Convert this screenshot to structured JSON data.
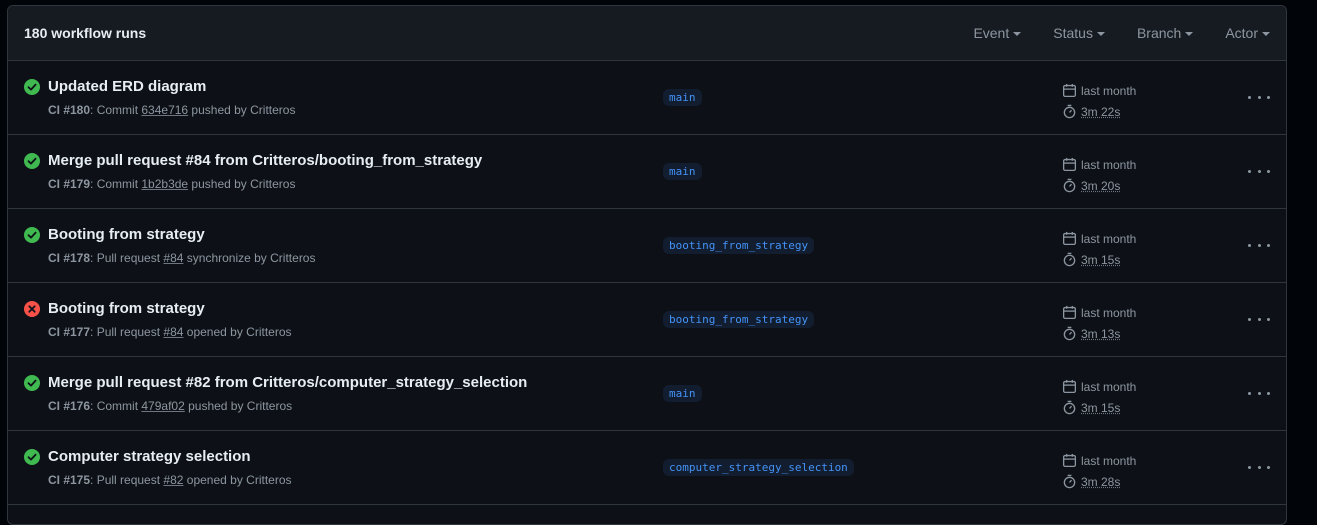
{
  "header": {
    "title": "180 workflow runs",
    "filters": [
      "Event",
      "Status",
      "Branch",
      "Actor"
    ]
  },
  "colors": {
    "success": "#3fb950",
    "failure": "#f85149",
    "branch_text": "#4493f8"
  },
  "runs": [
    {
      "status": "success",
      "title": "Updated ERD diagram",
      "workflow": "CI #180",
      "event_prefix": ": Commit ",
      "ref": "634e716",
      "event_suffix": " pushed by Critteros",
      "branch": "main",
      "when": "last month",
      "duration": "3m 22s"
    },
    {
      "status": "success",
      "title": "Merge pull request #84 from Critteros/booting_from_strategy",
      "workflow": "CI #179",
      "event_prefix": ": Commit ",
      "ref": "1b2b3de",
      "event_suffix": " pushed by Critteros",
      "branch": "main",
      "when": "last month",
      "duration": "3m 20s"
    },
    {
      "status": "success",
      "title": "Booting from strategy",
      "workflow": "CI #178",
      "event_prefix": ": Pull request ",
      "ref": "#84",
      "event_suffix": " synchronize by Critteros",
      "branch": "booting_from_strategy",
      "when": "last month",
      "duration": "3m 15s"
    },
    {
      "status": "failure",
      "title": "Booting from strategy",
      "workflow": "CI #177",
      "event_prefix": ": Pull request ",
      "ref": "#84",
      "event_suffix": " opened by Critteros",
      "branch": "booting_from_strategy",
      "when": "last month",
      "duration": "3m 13s"
    },
    {
      "status": "success",
      "title": "Merge pull request #82 from Critteros/computer_strategy_selection",
      "workflow": "CI #176",
      "event_prefix": ": Commit ",
      "ref": "479af02",
      "event_suffix": " pushed by Critteros",
      "branch": "main",
      "when": "last month",
      "duration": "3m 15s"
    },
    {
      "status": "success",
      "title": "Computer strategy selection",
      "workflow": "CI #175",
      "event_prefix": ": Pull request ",
      "ref": "#82",
      "event_suffix": " opened by Critteros",
      "branch": "computer_strategy_selection",
      "when": "last month",
      "duration": "3m 28s"
    }
  ]
}
